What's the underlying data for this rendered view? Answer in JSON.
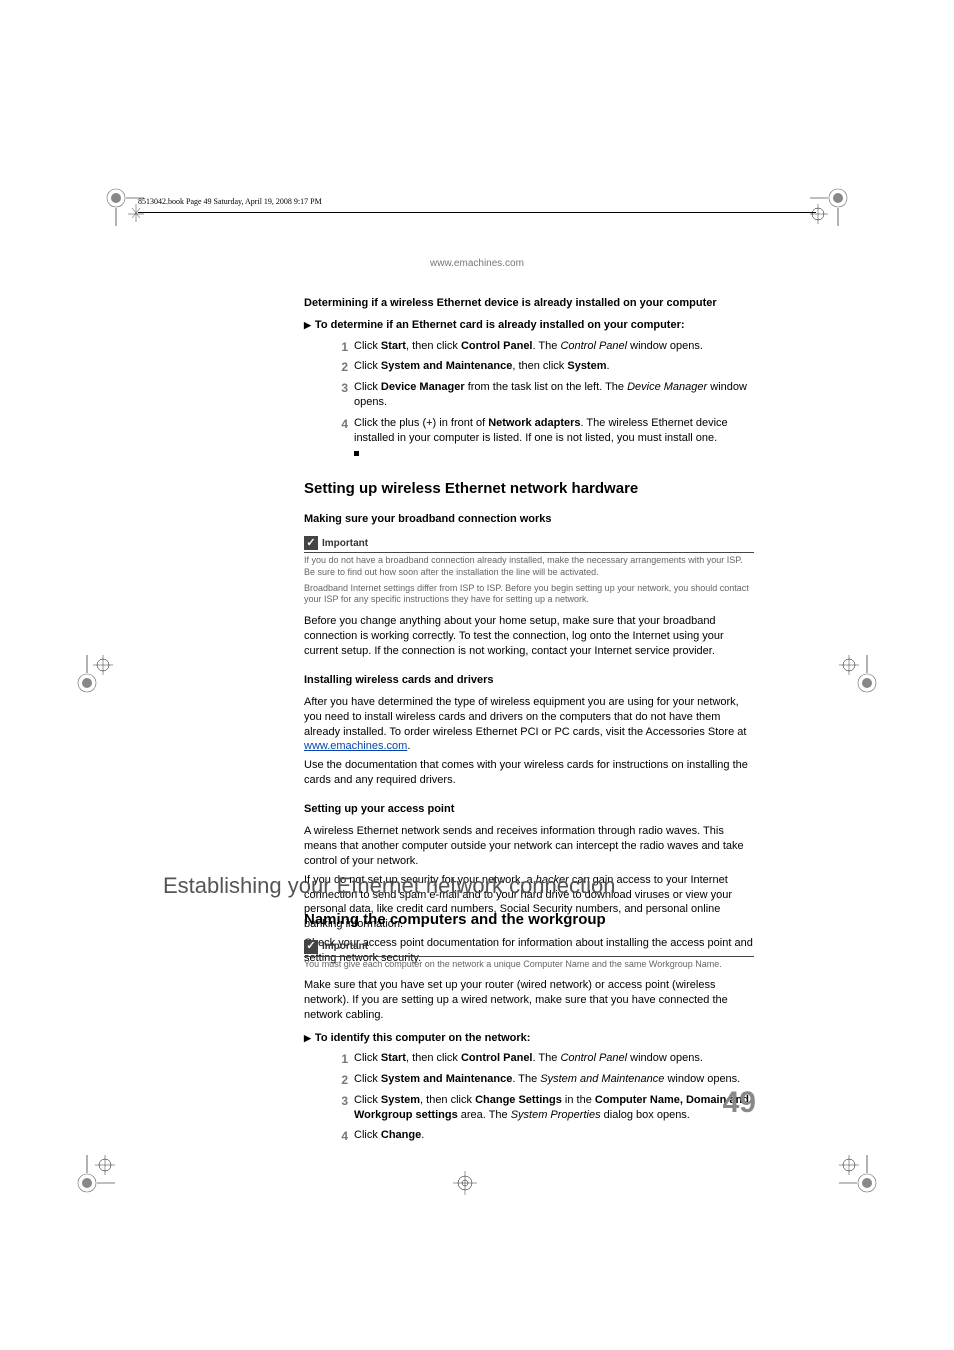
{
  "header_meta": "8513042.book  Page 49  Saturday, April 19, 2008  9:17 PM",
  "url": "www.emachines.com",
  "sec1": {
    "title": "Determining if a wireless Ethernet device is already installed on your computer",
    "task": "To determine if an Ethernet card is already installed on your computer:",
    "steps": [
      {
        "num": "1",
        "parts": [
          {
            "t": "Click ",
            "b": false
          },
          {
            "t": "Start",
            "b": true
          },
          {
            "t": ", then click ",
            "b": false
          },
          {
            "t": "Control Panel",
            "b": true
          },
          {
            "t": ". The ",
            "b": false
          },
          {
            "t": "Control Panel",
            "i": true
          },
          {
            "t": " window opens.",
            "b": false
          }
        ]
      },
      {
        "num": "2",
        "parts": [
          {
            "t": "Click ",
            "b": false
          },
          {
            "t": "System and Maintenance",
            "b": true
          },
          {
            "t": ", then click ",
            "b": false
          },
          {
            "t": "System",
            "b": true
          },
          {
            "t": ".",
            "b": false
          }
        ]
      },
      {
        "num": "3",
        "parts": [
          {
            "t": "Click ",
            "b": false
          },
          {
            "t": "Device Manager",
            "b": true
          },
          {
            "t": " from the task list on the left. The ",
            "b": false
          },
          {
            "t": "Device Manager",
            "i": true
          },
          {
            "t": " window opens.",
            "b": false
          }
        ]
      },
      {
        "num": "4",
        "end": true,
        "parts": [
          {
            "t": "Click the plus (+) in front of ",
            "b": false
          },
          {
            "t": "Network adapters",
            "b": true
          },
          {
            "t": ". The wireless Ethernet device installed in your computer is listed. If one is not listed, you must install one.",
            "b": false
          }
        ]
      }
    ]
  },
  "sec2": {
    "title": "Setting up wireless Ethernet network hardware",
    "sub1": "Making sure your broadband connection works",
    "callout_label": "Important",
    "callout_body": [
      "If you do not have a broadband connection already installed, make the necessary arrangements with your ISP. Be sure to find out how soon after the installation the line will be activated.",
      "Broadband Internet settings differ from ISP to ISP. Before you begin setting up your network, you should contact your ISP for any specific instructions they have for setting up a network."
    ],
    "para1": "Before you change anything about your home setup, make sure that your broadband connection is working correctly. To test the connection, log onto the Internet using your current setup. If the connection is not working, contact your Internet service provider.",
    "sub2": "Installing wireless cards and drivers",
    "para2a": "After you have determined the type of wireless equipment you are using for your network, you need to install wireless cards and drivers on the computers that do not have them already installed. To order wireless Ethernet PCI or PC cards, visit the Accessories Store at ",
    "link2": "www.emachines.com",
    "para2b": ".",
    "para3": "Use the documentation that comes with your wireless cards for instructions on installing the cards and any required drivers.",
    "sub3": "Setting up your access point",
    "para4": "A wireless Ethernet network sends and receives information through radio waves. This means that another computer outside your network can intercept the radio waves and take control of your network.",
    "para5_pre": "If you do not set up security for your network, a ",
    "para5_i": "hacker",
    "para5_post": " can gain access to your Internet connection to send spam e-mail and to your hard drive to download viruses or view your personal data, like credit card numbers, Social Security numbers, and personal online banking information.",
    "para6": "Check your access point documentation for information about installing the access point and setting network security."
  },
  "major": "Establishing your Ethernet network connection",
  "sec3": {
    "title": "Naming the computers and the workgroup",
    "callout_label": "Important",
    "callout_body": [
      "You must give each computer on the network a unique Computer Name and the same Workgroup Name."
    ],
    "para1": "Make sure that you have set up your router (wired network) or access point (wireless network). If you are setting up a wired network, make sure that you have connected the network cabling.",
    "task": "To identify this computer on the network:",
    "steps": [
      {
        "num": "1",
        "parts": [
          {
            "t": "Click ",
            "b": false
          },
          {
            "t": "Start",
            "b": true
          },
          {
            "t": ", then click ",
            "b": false
          },
          {
            "t": "Control Panel",
            "b": true
          },
          {
            "t": ". The ",
            "b": false
          },
          {
            "t": "Control Panel",
            "i": true
          },
          {
            "t": " window opens.",
            "b": false
          }
        ]
      },
      {
        "num": "2",
        "parts": [
          {
            "t": "Click ",
            "b": false
          },
          {
            "t": "System and Maintenance",
            "b": true
          },
          {
            "t": ". The ",
            "b": false
          },
          {
            "t": "System and Maintenance",
            "i": true
          },
          {
            "t": " window opens.",
            "b": false
          }
        ]
      },
      {
        "num": "3",
        "parts": [
          {
            "t": "Click ",
            "b": false
          },
          {
            "t": "System",
            "b": true
          },
          {
            "t": ", then click ",
            "b": false
          },
          {
            "t": "Change Settings",
            "b": true
          },
          {
            "t": " in the ",
            "b": false
          },
          {
            "t": "Computer Name, Domain and Workgroup settings",
            "b": true
          },
          {
            "t": " area. The ",
            "b": false
          },
          {
            "t": "System Properties",
            "i": true
          },
          {
            "t": " dialog box opens.",
            "b": false
          }
        ]
      },
      {
        "num": "4",
        "parts": [
          {
            "t": "Click ",
            "b": false
          },
          {
            "t": "Change",
            "b": true
          },
          {
            "t": ".",
            "b": false
          }
        ]
      }
    ]
  },
  "page_number": "49"
}
